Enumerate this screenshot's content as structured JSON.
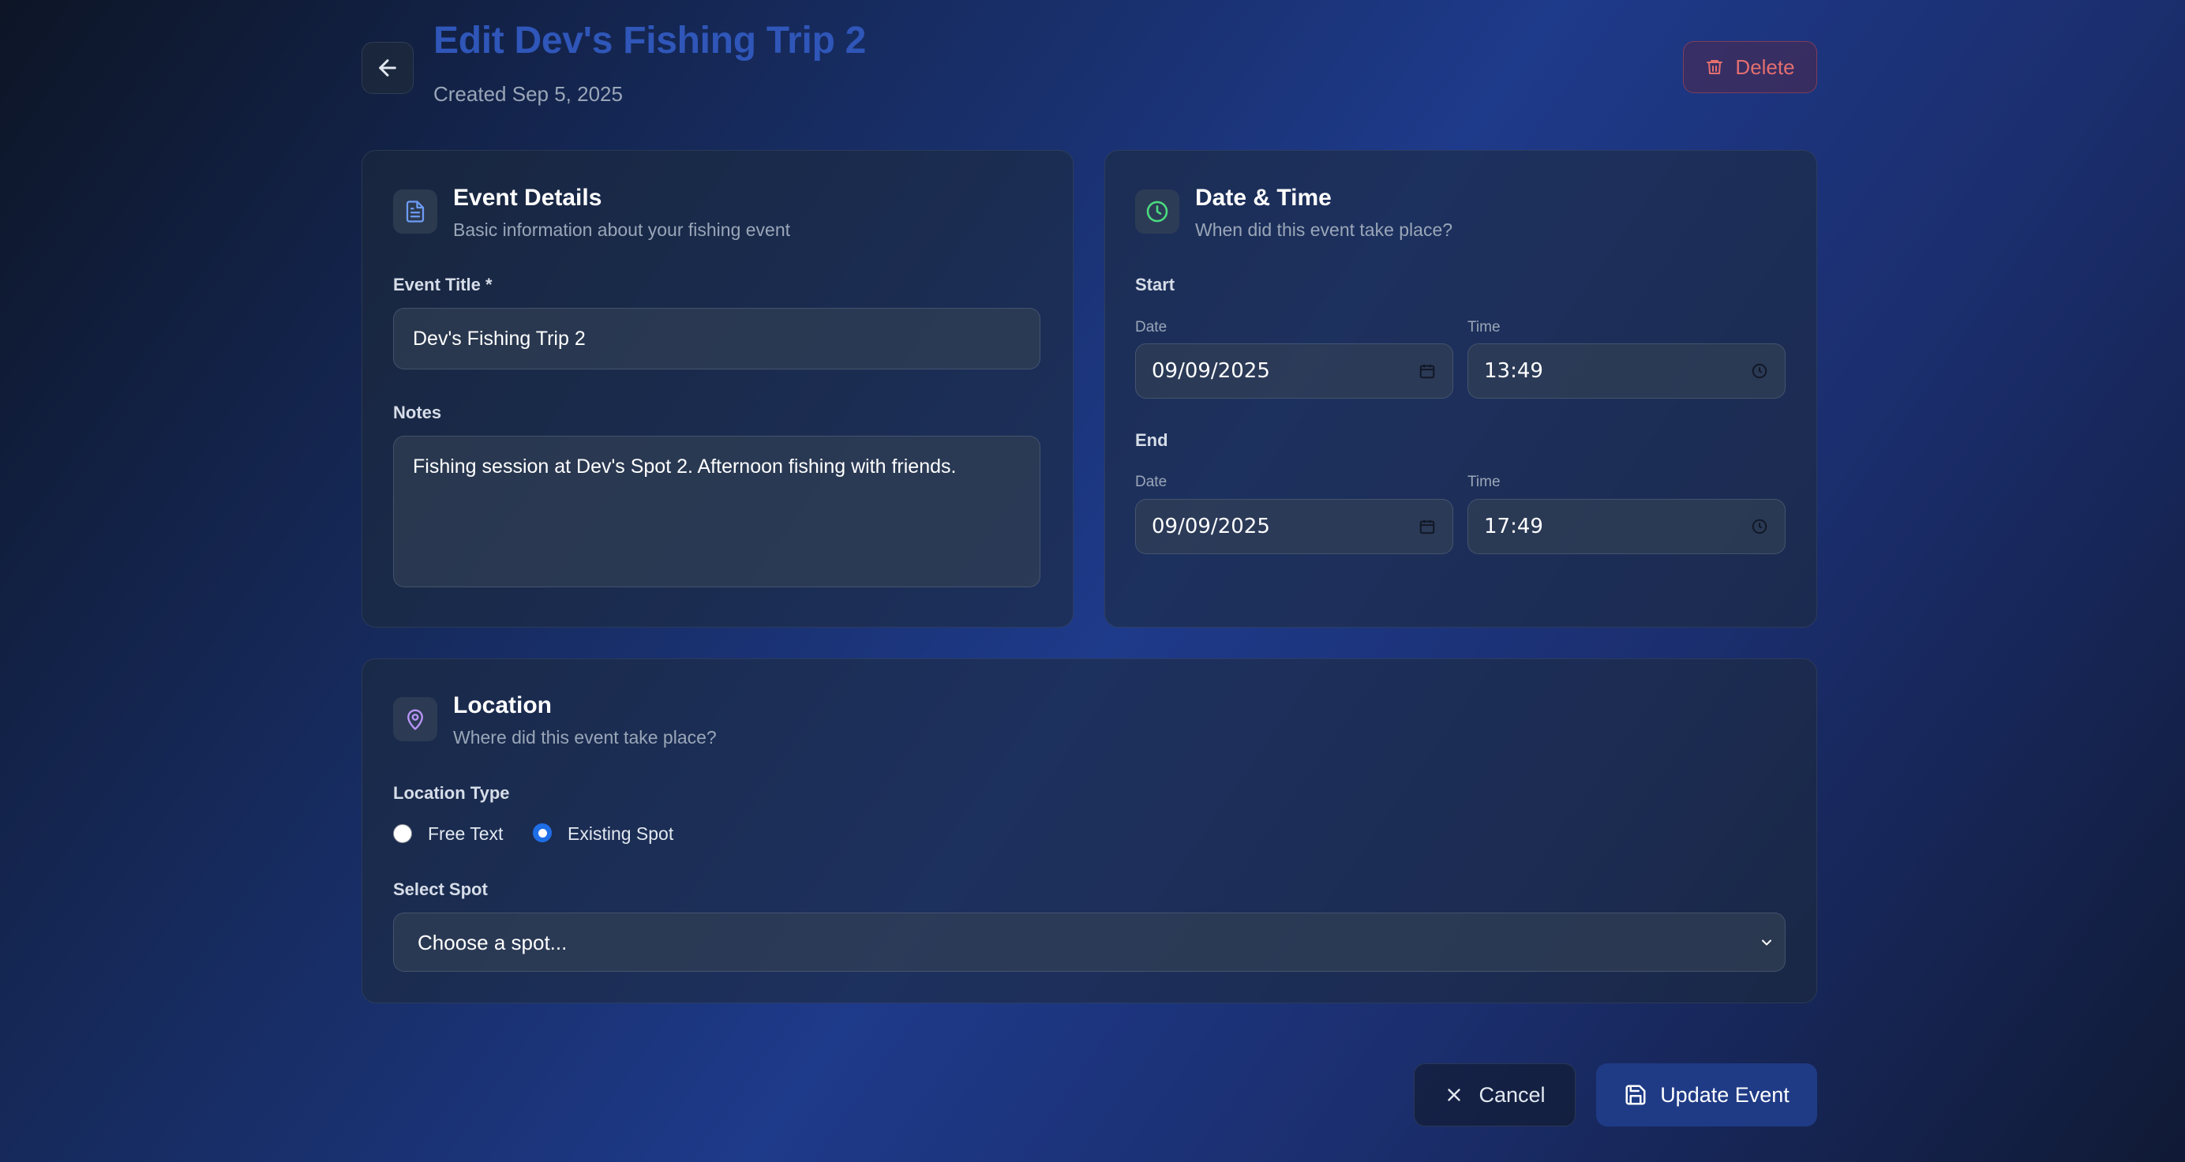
{
  "header": {
    "title": "Edit Dev's Fishing Trip 2",
    "created": "Created Sep 5, 2025",
    "delete_label": "Delete"
  },
  "event_details": {
    "title": "Event Details",
    "description": "Basic information about your fishing event",
    "event_title_label": "Event Title *",
    "event_title_value": "Dev's Fishing Trip 2",
    "notes_label": "Notes",
    "notes_value": "Fishing session at Dev's Spot 2. Afternoon fishing with friends."
  },
  "date_time": {
    "title": "Date & Time",
    "description": "When did this event take place?",
    "start_label": "Start",
    "end_label": "End",
    "date_label": "Date",
    "time_label": "Time",
    "start_date": "09/09/2025",
    "start_time": "13:49",
    "end_date": "09/09/2025",
    "end_time": "17:49"
  },
  "location": {
    "title": "Location",
    "description": "Where did this event take place?",
    "type_label": "Location Type",
    "options": [
      "Free Text",
      "Existing Spot"
    ],
    "selected_option": "Existing Spot",
    "select_spot_label": "Select Spot",
    "select_spot_value": "Choose a spot..."
  },
  "actions": {
    "cancel_label": "Cancel",
    "update_label": "Update Event"
  },
  "colors": {
    "title_blue": "#2f56b8",
    "delete_red": "#e46f6f",
    "primary_button": "#1f3b86",
    "radio_checked": "#1e6ee6",
    "icon_blue": "#6d9cf5",
    "icon_green": "#4ade80",
    "icon_purple": "#b794f6"
  },
  "icons": {
    "back": "arrow-left-icon",
    "delete": "trash-icon",
    "event_details": "document-icon",
    "date_time": "clock-icon",
    "location": "map-pin-icon",
    "date_picker": "calendar-icon",
    "time_picker": "clock-icon",
    "select": "chevron-down-icon",
    "cancel": "x-icon",
    "update": "save-icon"
  }
}
